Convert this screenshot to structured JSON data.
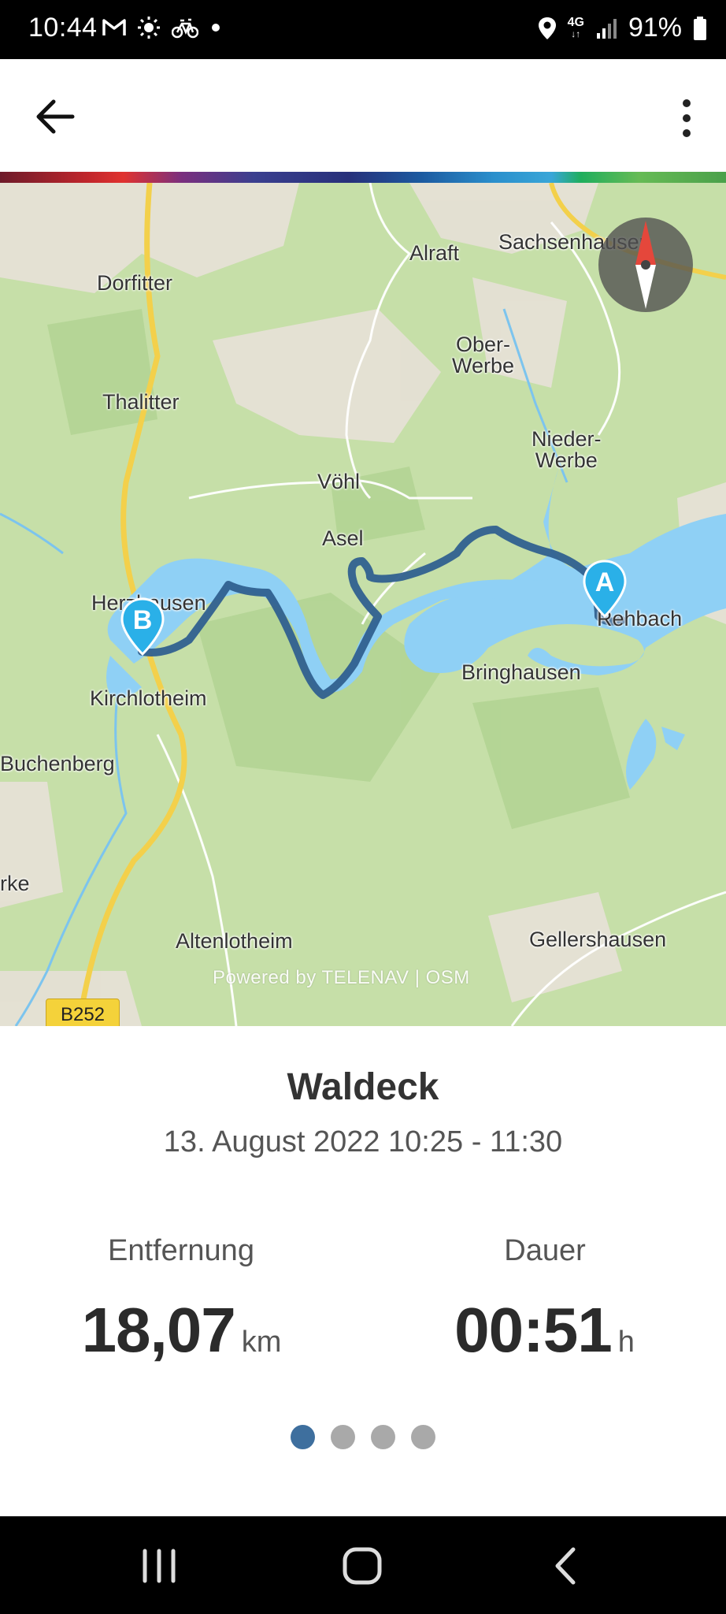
{
  "status_bar": {
    "time": "10:44",
    "network": "4G",
    "battery": "91%",
    "icons": [
      "gmail-icon",
      "sun-icon",
      "bicycle-icon",
      "dot-icon",
      "location-icon",
      "network-icon",
      "signal-icon",
      "battery-icon"
    ]
  },
  "app_bar": {
    "back_icon": "arrow-left-icon",
    "menu_icon": "more-vert-icon"
  },
  "map": {
    "places": {
      "sachsenhausen": "Sachsenhausen",
      "alraft": "Alraft",
      "dorfitter": "Dorfitter",
      "ober_werbe": "Ober-\nWerbe",
      "thalitter": "Thalitter",
      "nieder_werbe": "Nieder-\nWerbe",
      "vohl": "Vöhl",
      "asel": "Asel",
      "herzhausen": "Herzhausen",
      "rehbach": "Rehbach",
      "bringhausen": "Bringhausen",
      "kirchlotheim": "Kirchlotheim",
      "buchenberg": "Buchenberg",
      "rke": "rke",
      "altenlotheim": "Altenlotheim",
      "gellershausen": "Gellershausen"
    },
    "road_badge": "B252",
    "powered_by": "Powered by TELENAV | OSM",
    "marker_start": "A",
    "marker_end": "B",
    "colors": {
      "water": "#8fd0f5",
      "forest": "#c2dca3",
      "field": "#e6e0d6",
      "route": "#30608f",
      "marker": "#2ab0e8"
    }
  },
  "trip": {
    "title": "Waldeck",
    "datetime": "13. August 2022 10:25 - 11:30",
    "distance_label": "Entfernung",
    "distance_value": "18,07",
    "distance_unit": "km",
    "duration_label": "Dauer",
    "duration_value": "00:51",
    "duration_unit": "h",
    "pages": 4,
    "active_page": 1
  },
  "nav_bar": {
    "icons": [
      "recent-apps-icon",
      "home-icon",
      "back-icon"
    ]
  }
}
